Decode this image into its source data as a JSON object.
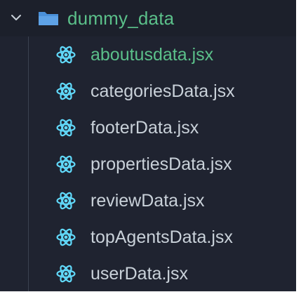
{
  "explorer": {
    "folder": {
      "name": "dummy_data",
      "expanded": true,
      "icon": "folder-icon",
      "chevron_icon": "chevron-down-icon",
      "color": "#5bc08a"
    },
    "files": [
      {
        "name": "aboutusdata.jsx",
        "icon": "react-icon",
        "active": true
      },
      {
        "name": "categoriesData.jsx",
        "icon": "react-icon",
        "active": false
      },
      {
        "name": "footerData.jsx",
        "icon": "react-icon",
        "active": false
      },
      {
        "name": "propertiesData.jsx",
        "icon": "react-icon",
        "active": false
      },
      {
        "name": "reviewData.jsx",
        "icon": "react-icon",
        "active": false
      },
      {
        "name": "topAgentsData.jsx",
        "icon": "react-icon",
        "active": false
      },
      {
        "name": "userData.jsx",
        "icon": "react-icon",
        "active": false
      }
    ]
  },
  "colors": {
    "background": "#1f2330",
    "text": "#c9d1d9",
    "accent": "#5bc08a",
    "folder_icon": "#4a90d9",
    "react_icon": "#61dafb"
  }
}
